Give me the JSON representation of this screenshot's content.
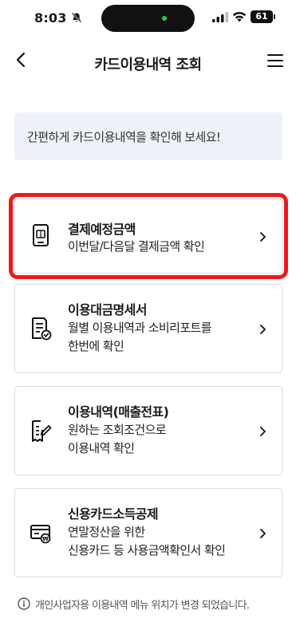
{
  "status_bar": {
    "time": "8:03",
    "battery": "61"
  },
  "header": {
    "title": "카드이용내역 조회",
    "back_icon": "chevron-left-icon",
    "menu_icon": "hamburger-menu-icon"
  },
  "banner": {
    "text": "간편하게 카드이용내역을 확인해 보세요!"
  },
  "cards": [
    {
      "title": "결제예정금액",
      "desc": [
        "이번달/다음달 결제금액 확인"
      ],
      "icon": "mobile-payment-icon"
    },
    {
      "title": "이용대금명세서",
      "desc": [
        "월별 이용내역과 소비리포트를",
        "한번에 확인"
      ],
      "icon": "statement-check-icon"
    },
    {
      "title": "이용내역(매출전표)",
      "desc": [
        "원하는 조회조건으로",
        "이용내역 확인"
      ],
      "icon": "receipt-edit-icon"
    },
    {
      "title": "신용카드소득공제",
      "desc": [
        "연말정산을 위한",
        "신용카드 등 사용금액확인서 확인"
      ],
      "icon": "card-deduction-icon"
    }
  ],
  "footer": {
    "note": "개인사업자용 이용내역 메뉴 위치가 변경 되었습니다."
  },
  "colors": {
    "highlight": "#f01818",
    "banner_bg": "#eef2f8",
    "border": "#d9dce1"
  }
}
